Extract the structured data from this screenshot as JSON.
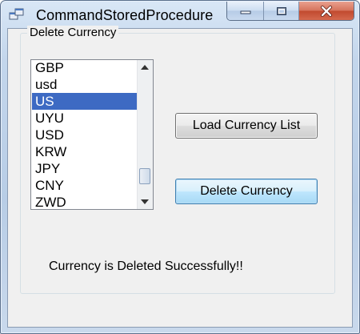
{
  "window": {
    "title": "CommandStoredProcedure"
  },
  "groupbox": {
    "label": "Delete Currency"
  },
  "currency_list": {
    "items": [
      "GBP",
      "usd",
      "US",
      "UYU",
      "USD",
      "KRW",
      "JPY",
      "CNY",
      "ZWD"
    ],
    "selected": "US"
  },
  "buttons": {
    "load_label": "Load Currency List",
    "delete_label": "Delete Currency"
  },
  "status": {
    "message": "Currency is Deleted Successfully!!"
  },
  "icons": {
    "app": "app-window-icon",
    "minimize": "minimize-icon",
    "maximize": "maximize-icon",
    "close": "close-icon",
    "scroll_up": "scroll-up-arrow-icon",
    "scroll_down": "scroll-down-arrow-icon"
  },
  "colors": {
    "selection": "#3d6ac3",
    "close_button": "#c14a2f"
  }
}
